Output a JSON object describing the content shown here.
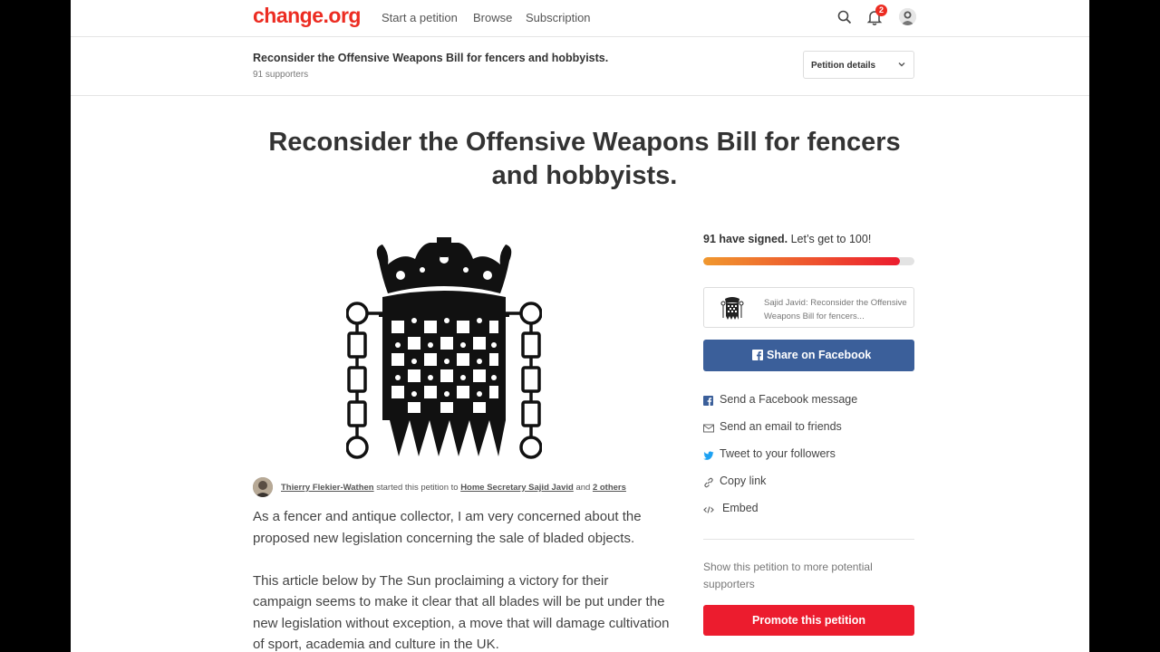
{
  "nav": {
    "logo": "change.org",
    "links": [
      "Start a petition",
      "Browse",
      "Subscription"
    ],
    "notification_count": "2"
  },
  "header": {
    "title": "Reconsider the Offensive Weapons Bill for fencers and hobbyists.",
    "supporters": "91 supporters",
    "details_label": "Petition details"
  },
  "petition": {
    "title": "Reconsider the Offensive Weapons Bill for fencers and hobbyists.",
    "starter_name": "Thierry Flekier-Wathen",
    "started_text": " started this petition to ",
    "target": "Home Secretary Sajid Javid",
    "and_text": " and ",
    "others": "2 others",
    "paragraphs": [
      "As a fencer and antique collector, I am very concerned about the proposed new legislation concerning the sale of bladed objects.",
      "This article below by The Sun proclaiming a victory for their campaign seems to make it clear that all blades will be put under the new legislation without exception, a move that will damage cultivation of sport, academia and culture in the UK."
    ]
  },
  "sidebar": {
    "signed_count": "91 have signed.",
    "signed_goal": " Let’s get to 100!",
    "progress": 0.93,
    "card_text": "Sajid Javid: Reconsider the Offensive Weapons Bill for fencers...",
    "facebook_button": "Share on Facebook",
    "share_items": [
      {
        "label": "Send a Facebook message",
        "icon": "facebook-icon"
      },
      {
        "label": "Send an email to friends",
        "icon": "email-icon"
      },
      {
        "label": "Tweet to your followers",
        "icon": "twitter-icon"
      },
      {
        "label": "Copy link",
        "icon": "link-icon"
      },
      {
        "label": "Embed",
        "icon": "embed-icon"
      }
    ],
    "promo_text": "Show this petition to more potential supporters",
    "promote_button": "Promote this petition"
  },
  "colors": {
    "brand": "#ec2c22",
    "facebook": "#3b5f9a",
    "promote": "#ec1c2e"
  }
}
